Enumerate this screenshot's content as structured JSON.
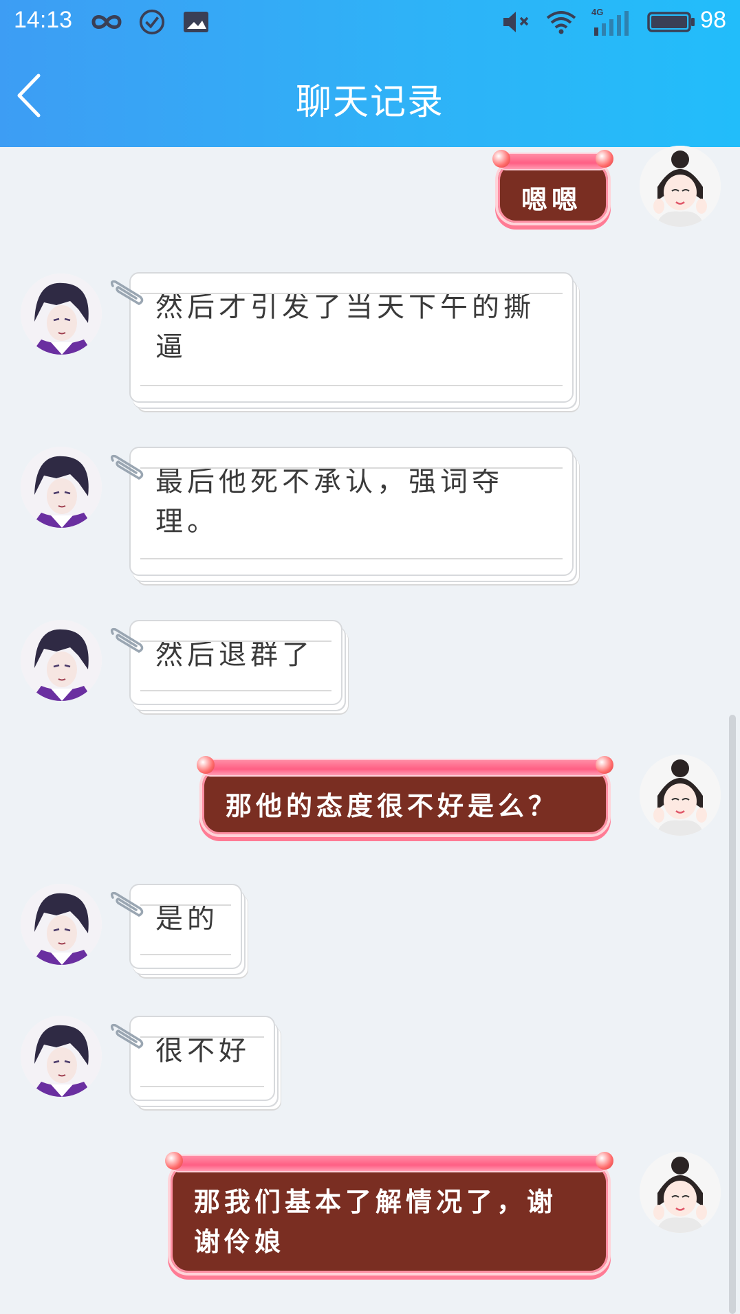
{
  "status_bar": {
    "time": "14:13",
    "network": "4G",
    "battery": "98",
    "icons": [
      "infinity-icon",
      "check-circle-icon",
      "image-icon",
      "mute-icon",
      "wifi-icon",
      "signal-icon",
      "battery-icon"
    ]
  },
  "header": {
    "back_icon": "chevron-left-icon",
    "title": "聊天记录"
  },
  "colors": {
    "header_start": "#3d9df4",
    "header_end": "#22bdfa",
    "background": "#eef2f6",
    "outgoing_bubble": "#7a2e22",
    "outgoing_ribbon": "#ff6f8f"
  },
  "messages": [
    {
      "side": "out",
      "text": "嗯嗯"
    },
    {
      "side": "in",
      "text": "然后才引发了当天下午的撕逼"
    },
    {
      "side": "in",
      "text": "最后他死不承认，强词夺理。"
    },
    {
      "side": "in",
      "text": "然后退群了"
    },
    {
      "side": "out",
      "text": "那他的态度很不好是么？"
    },
    {
      "side": "in",
      "text": "是的"
    },
    {
      "side": "in",
      "text": "很不好"
    },
    {
      "side": "out",
      "text": "那我们基本了解情况了，谢谢伶娘"
    }
  ]
}
